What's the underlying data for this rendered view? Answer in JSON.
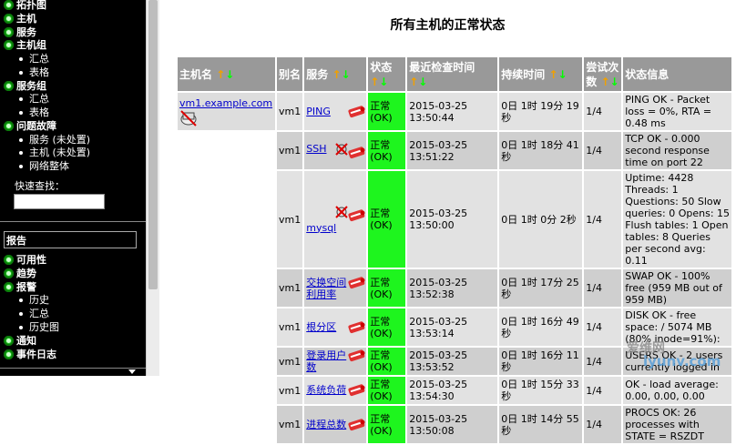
{
  "sidebar": {
    "items": [
      {
        "type": "top",
        "label": "拓扑图"
      },
      {
        "type": "top",
        "label": "主机"
      },
      {
        "type": "top",
        "label": "服务"
      },
      {
        "type": "top",
        "label": "主机组"
      },
      {
        "type": "sub",
        "label": "汇总"
      },
      {
        "type": "sub",
        "label": "表格"
      },
      {
        "type": "top",
        "label": "服务组"
      },
      {
        "type": "sub",
        "label": "汇总"
      },
      {
        "type": "sub",
        "label": "表格"
      },
      {
        "type": "top",
        "label": "问题故障"
      },
      {
        "type": "sub",
        "label": "服务 (未处置)"
      },
      {
        "type": "sub",
        "label": "主机 (未处置)"
      },
      {
        "type": "sub",
        "label": "网络整体"
      }
    ],
    "quick_search_label": "快速查找：",
    "quick_search_value": "",
    "reports_header": "报告",
    "report_items": [
      {
        "type": "top",
        "label": "可用性"
      },
      {
        "type": "top",
        "label": "趋势"
      },
      {
        "type": "top",
        "label": "报警"
      },
      {
        "type": "sub",
        "label": "历史"
      },
      {
        "type": "sub",
        "label": "汇总"
      },
      {
        "type": "sub",
        "label": "历史图"
      },
      {
        "type": "top",
        "label": "通知"
      },
      {
        "type": "top",
        "label": "事件日志"
      }
    ]
  },
  "main": {
    "title": "所有主机的正常状态",
    "headers": {
      "host": "主机名",
      "alias": "别名",
      "service": "服务",
      "status": "状态",
      "last_check": "最近检查时间",
      "duration": "持续时间",
      "attempts": "尝试次数",
      "info": "状态信息"
    },
    "host_link": "vm1.example.com",
    "rows": [
      {
        "alias": "vm1",
        "service": "PING",
        "status": "正常 (OK)",
        "last_check": "2015-03-25 13:50:44",
        "duration": "0日 1时 19分 19秒",
        "attempts": "1/4",
        "info": "PING OK - Packet loss = 0%, RTA = 0.48 ms",
        "disabled": false
      },
      {
        "alias": "vm1",
        "service": "SSH",
        "status": "正常 (OK)",
        "last_check": "2015-03-25 13:51:22",
        "duration": "0日 1时 18分 41秒",
        "attempts": "1/4",
        "info": "TCP OK - 0.000 second response time on port 22",
        "disabled": true
      },
      {
        "alias": "vm1",
        "service": "mysql",
        "status": "正常 (OK)",
        "last_check": "2015-03-25 13:50:00",
        "duration": "0日 1时 0分 2秒",
        "attempts": "1/4",
        "info": "Uptime: 4428 Threads: 1 Questions: 50 Slow queries: 0 Opens: 15 Flush tables: 1 Open tables: 8 Queries per second avg: 0.11",
        "disabled": true
      },
      {
        "alias": "vm1",
        "service": "交换空间利用率",
        "status": "正常 (OK)",
        "last_check": "2015-03-25 13:52:38",
        "duration": "0日 1时 17分 25秒",
        "attempts": "1/4",
        "info": "SWAP OK - 100% free (959 MB out of 959 MB)",
        "disabled": false
      },
      {
        "alias": "vm1",
        "service": "根分区",
        "status": "正常 (OK)",
        "last_check": "2015-03-25 13:53:14",
        "duration": "0日 1时 16分 49秒",
        "attempts": "1/4",
        "info": "DISK OK - free space: / 5074 MB (80% inode=91%):",
        "disabled": false
      },
      {
        "alias": "vm1",
        "service": "登录用户数",
        "status": "正常 (OK)",
        "last_check": "2015-03-25 13:53:52",
        "duration": "0日 1时 16分 11秒",
        "attempts": "1/4",
        "info": "USERS OK - 2 users currently logged in",
        "disabled": false
      },
      {
        "alias": "vm1",
        "service": "系统负荷",
        "status": "正常 (OK)",
        "last_check": "2015-03-25 13:54:30",
        "duration": "0日 1时 15分 33秒",
        "attempts": "1/4",
        "info": "OK - load average: 0.00, 0.00, 0.00",
        "disabled": false
      },
      {
        "alias": "vm1",
        "service": "进程总数",
        "status": "正常 (OK)",
        "last_check": "2015-03-25 13:50:08",
        "duration": "0日 1时 14分 55秒",
        "attempts": "1/4",
        "info": "PROCS OK: 26 processes with STATE = RSZDT",
        "disabled": false
      }
    ]
  },
  "colors": {
    "ok": "#1ef51e",
    "header": "#999999",
    "sidebar_bg": "#000000",
    "bullet": "#1fbf1f"
  },
  "watermark": {
    "line1": "爱维网",
    "line2": "iyunv.com"
  }
}
